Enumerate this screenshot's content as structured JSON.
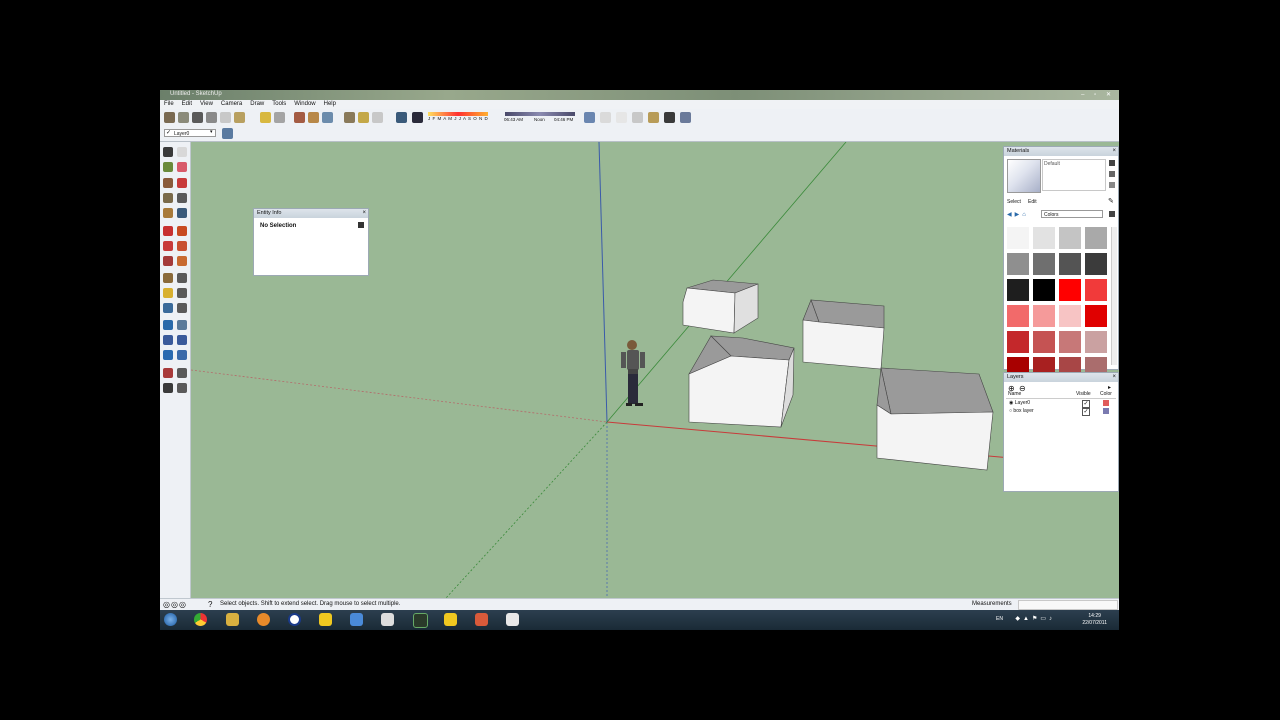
{
  "window": {
    "title": "Untitled - SketchUp",
    "controls": "– ▫ ✕"
  },
  "menu": [
    "File",
    "Edit",
    "View",
    "Camera",
    "Draw",
    "Tools",
    "Window",
    "Help"
  ],
  "shadow_bar": {
    "months": "J F M A M J J A S O N D",
    "time_start": "06:43 AM",
    "noon": "Noon",
    "time_end": "04:46 PM"
  },
  "layer_dropdown": {
    "value": "Layer0"
  },
  "entity_info": {
    "title": "Entity Info",
    "status": "No Selection"
  },
  "materials": {
    "title": "Materials",
    "name": "Default",
    "tab_select": "Select",
    "tab_edit": "Edit",
    "library": "Colors",
    "swatches": [
      "#f4f4f4",
      "#e2e2e2",
      "#c4c4c4",
      "#a9a9a9",
      "#8f8f8f",
      "#6f6f6f",
      "#545454",
      "#3b3b3b",
      "#1e1e1e",
      "#000000",
      "#ff0000",
      "#f13a3a",
      "#f26a6a",
      "#f59a9a",
      "#f7c4c4",
      "#e00000",
      "#c4282b",
      "#c55353",
      "#c77878",
      "#caa1a1",
      "#a80000",
      "#a82020",
      "#a84646",
      "#aa6d6d"
    ]
  },
  "layers": {
    "title": "Layers",
    "col_name": "Name",
    "col_visible": "Visible",
    "col_color": "Color",
    "rows": [
      {
        "name": "Layer0",
        "visible": "✓",
        "color": "#e05b5b"
      },
      {
        "name": "box layer",
        "visible": "✓",
        "color": "#7a7ab0"
      }
    ]
  },
  "status": {
    "message": "Select objects. Shift to extend select. Drag mouse to select multiple.",
    "measurements": "Measurements"
  },
  "taskbar": {
    "lang": "EN",
    "time": "14:29",
    "date": "22/07/2011"
  }
}
